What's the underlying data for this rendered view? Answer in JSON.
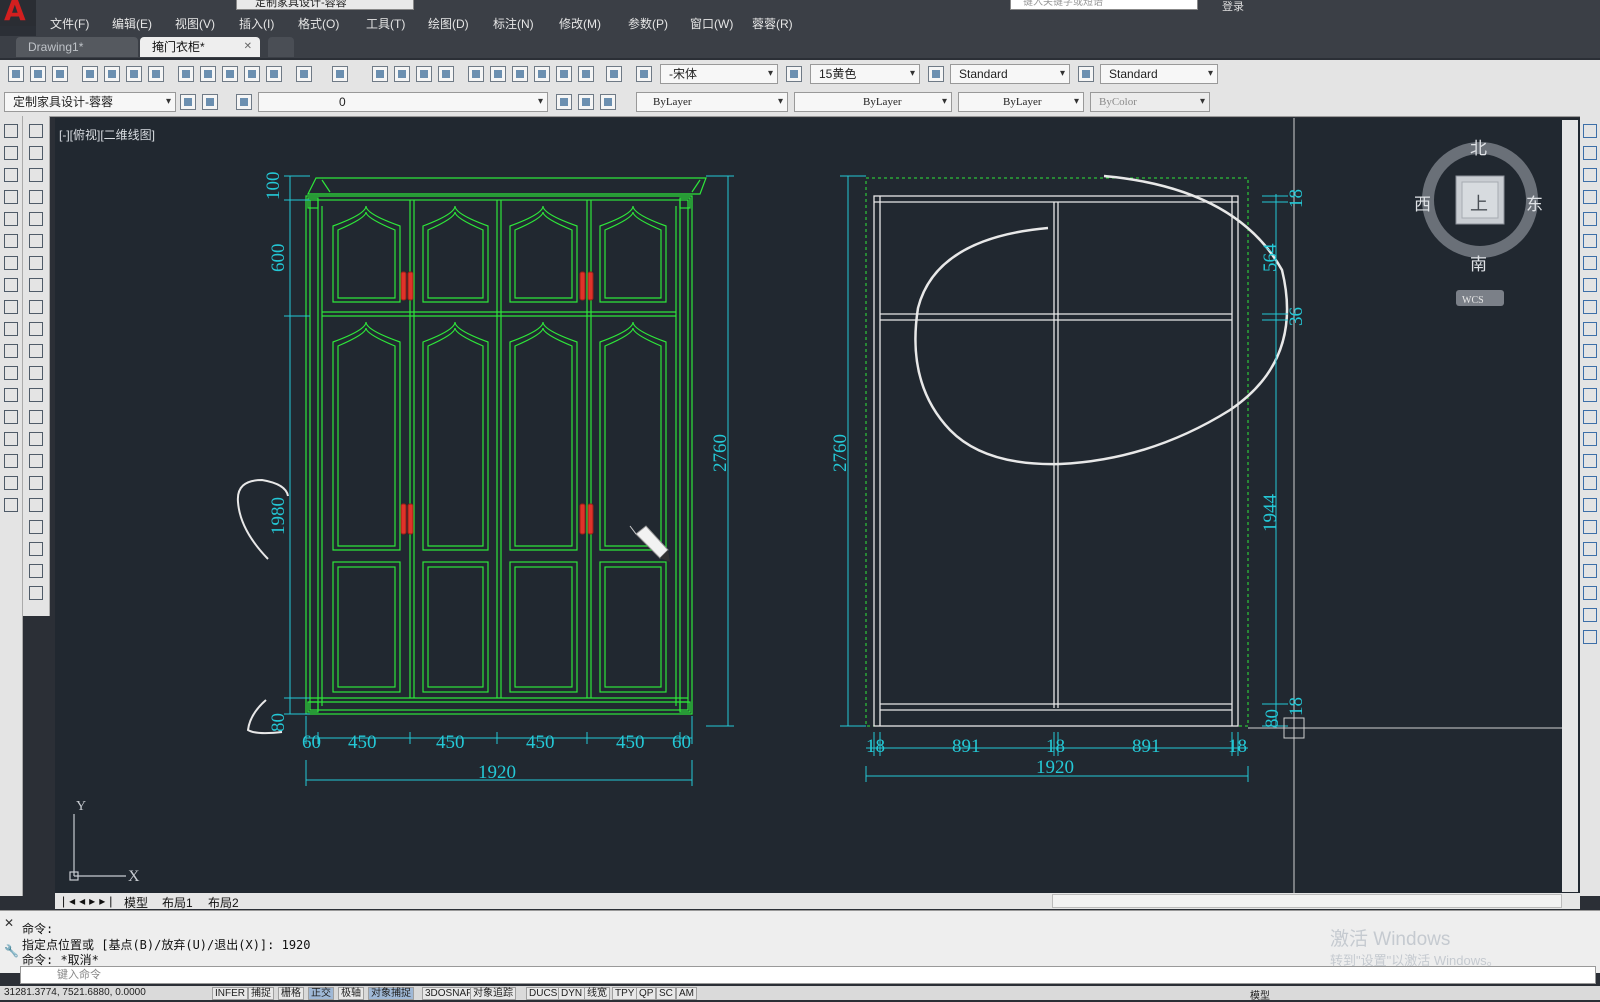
{
  "app": {
    "workspace": "定制家具设计-蓉蓉",
    "search_placeholder": "键入关键字或短语",
    "login_label": "登录",
    "window_controls": "– ❐ ×"
  },
  "menu": [
    "文件(F)",
    "编辑(E)",
    "视图(V)",
    "插入(I)",
    "格式(O)",
    "工具(T)",
    "绘图(D)",
    "标注(N)",
    "修改(M)",
    "参数(P)",
    "窗口(W)",
    "蓉蓉(R)"
  ],
  "tabs": [
    {
      "label": "Drawing1*",
      "active": false
    },
    {
      "label": "掩门衣柜*",
      "active": true
    }
  ],
  "toolbar1": {
    "font_combo": "-宋体",
    "color_combo": "15黄色",
    "textstyle_combo": "Standard",
    "dimstyle_combo": "Standard"
  },
  "toolbar2": {
    "workspace_combo": "定制家具设计-蓉蓉",
    "layer_combo": "0",
    "color_combo": "ByLayer",
    "linetype_combo": "ByLayer",
    "lineweight_combo": "ByLayer",
    "plotstyle_combo": "ByColor"
  },
  "drawing": {
    "view_label": "[-][俯视][二维线图]",
    "left_dims": {
      "v_100": "100",
      "v_600": "600",
      "v_1980": "1980",
      "v_80": "80",
      "v_2760": "2760",
      "h_60a": "60",
      "h_450a": "450",
      "h_450b": "450",
      "h_450c": "450",
      "h_450d": "450",
      "h_60b": "60",
      "h_1920": "1920"
    },
    "right_dims": {
      "v_2760": "2760",
      "v_18a": "18",
      "v_564": "564",
      "v_36": "36",
      "v_1944": "1944",
      "v_80": "80",
      "v_18b": "18",
      "h_18a": "18",
      "h_891a": "891",
      "h_18b": "18",
      "h_891b": "891",
      "h_18c": "18",
      "h_1920": "1920"
    },
    "ucs": {
      "y": "Y",
      "x": "X"
    }
  },
  "viewcube": {
    "north": "北",
    "south": "南",
    "west": "西",
    "east": "东",
    "face": "上",
    "wcs": "WCS"
  },
  "layout_tabs": [
    "模型",
    "布局1",
    "布局2"
  ],
  "command": {
    "lines": [
      "命令:",
      "指定点位置或 [基点(B)/放弃(U)/退出(X)]: 1920",
      "命令: *取消*"
    ],
    "input_placeholder": "键入命令"
  },
  "status": {
    "coords": "31281.3774, 7521.6880, 0.0000",
    "buttons": [
      "INFER",
      "捕捉",
      "栅格",
      "正交",
      "极轴",
      "对象捕捉",
      "3DOSNAP",
      "对象追踪",
      "DUCS",
      "DYN",
      "线宽",
      "TPY",
      "QP",
      "SC",
      "AM"
    ],
    "right": "模型"
  },
  "watermark": {
    "line1": "激活 Windows",
    "line2": "转到\"设置\"以激活 Windows。"
  },
  "colors": {
    "canvas": "#212830",
    "green": "#2ee63a",
    "cyan": "#24c8d6",
    "white": "#e8e8e8",
    "red": "#e0332a"
  }
}
